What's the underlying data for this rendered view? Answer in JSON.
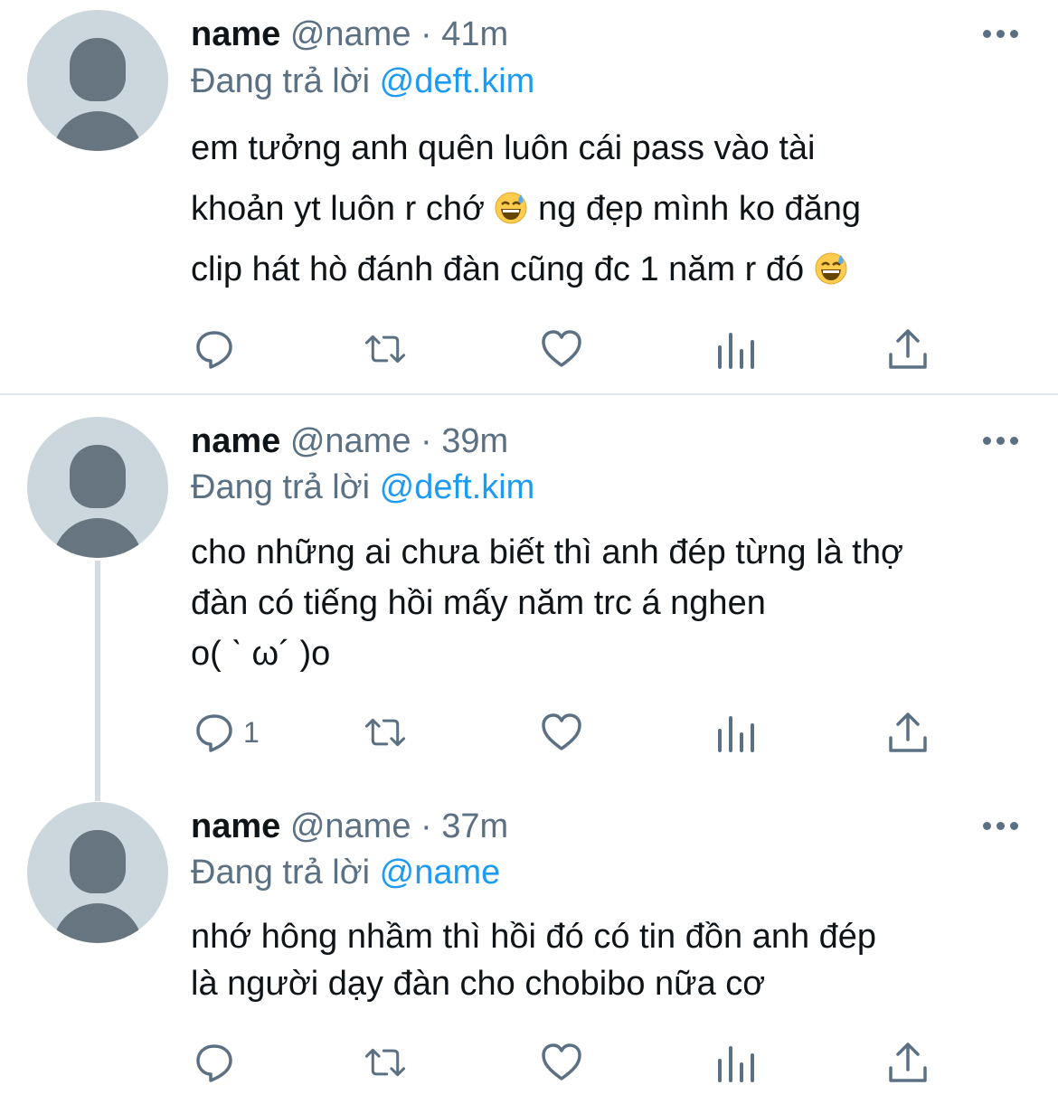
{
  "colors": {
    "text": "#0f1419",
    "secondary": "#5b7083",
    "link": "#1d9bf0",
    "avatar_bg": "#ccd6dd",
    "avatar_fg": "#66757f"
  },
  "tweets": [
    {
      "display_name": "name",
      "handle": "@name",
      "separator": "·",
      "time": "41m",
      "reply_prefix": "Đang trả lời",
      "reply_to": "@deft.kim",
      "lines": [
        "em tưởng anh quên luôn cái pass vào tài",
        "khoản yt luôn r chớ",
        "ng đẹp mình ko đăng",
        "clip hát hò đánh đàn cũng đc 1 năm r đó"
      ],
      "emoji": "grinning-face-with-sweat",
      "reply_count": ""
    },
    {
      "display_name": "name",
      "handle": "@name",
      "separator": "·",
      "time": "39m",
      "reply_prefix": "Đang trả lời",
      "reply_to": "@deft.kim",
      "lines": [
        "cho những ai chưa biết thì anh đép từng là thợ",
        "đàn có tiếng hồi mấy năm trc á nghen",
        "o( ˋ ω´ )o"
      ],
      "reply_count": "1"
    },
    {
      "display_name": "name",
      "handle": "@name",
      "separator": "·",
      "time": "37m",
      "reply_prefix": "Đang trả lời",
      "reply_to": "@name",
      "lines": [
        "nhớ hông nhầm thì hồi đó có tin đồn anh đép",
        "là người dạy đàn cho chobibo nữa cơ"
      ],
      "reply_count": ""
    }
  ],
  "action_icons": [
    "reply-icon",
    "retweet-icon",
    "like-icon",
    "analytics-icon",
    "share-icon"
  ]
}
